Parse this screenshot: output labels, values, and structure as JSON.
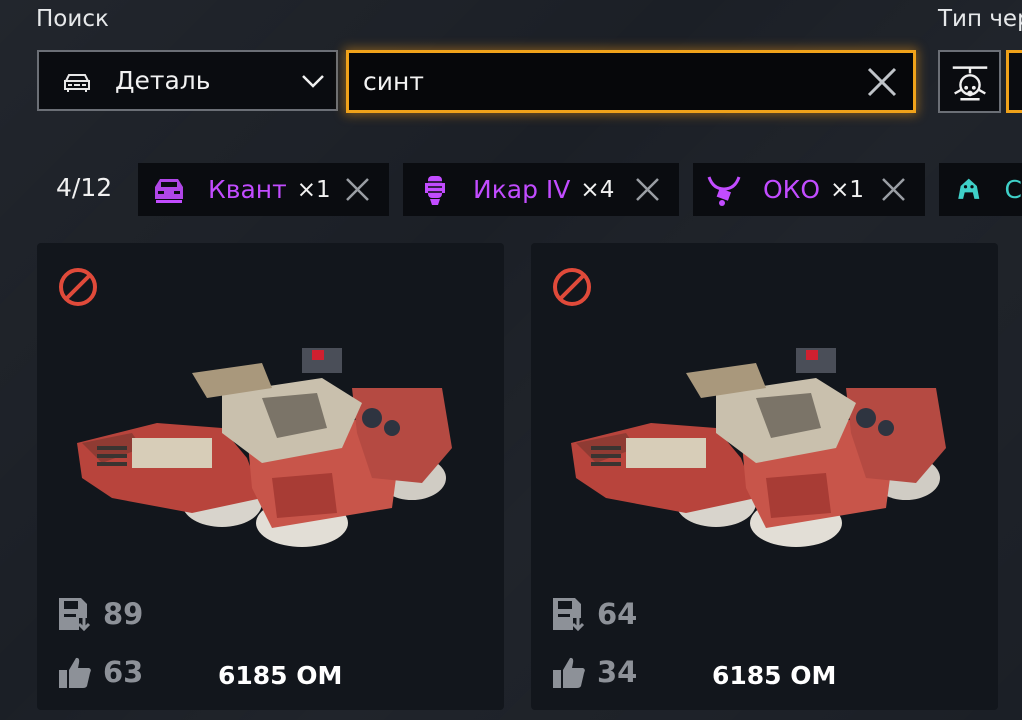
{
  "filters": {
    "search_label": "Поиск",
    "type_label": "Тип чер",
    "category": {
      "value": "Деталь",
      "icon": "car-icon"
    },
    "search": {
      "value": "синт",
      "placeholder": ""
    }
  },
  "results": {
    "count": "4/12",
    "chips": [
      {
        "name": "Квант",
        "qty": "×1",
        "icon": "cabin-icon"
      },
      {
        "name": "Икар IV",
        "qty": "×4",
        "icon": "hover-icon"
      },
      {
        "name": "ОКО",
        "qty": "×1",
        "icon": "horns-icon"
      },
      {
        "name": "С",
        "qty": "",
        "icon": "robot-icon"
      }
    ]
  },
  "cards": [
    {
      "downloads": "89",
      "likes": "63",
      "price": "6185 OM"
    },
    {
      "downloads": "64",
      "likes": "34",
      "price": "6185 OM"
    }
  ],
  "colors": {
    "accent": "#f0a21a",
    "chip_text": "#c24cff",
    "chip_text_alt": "#3fd0c8",
    "ban": "#e04a3a"
  }
}
